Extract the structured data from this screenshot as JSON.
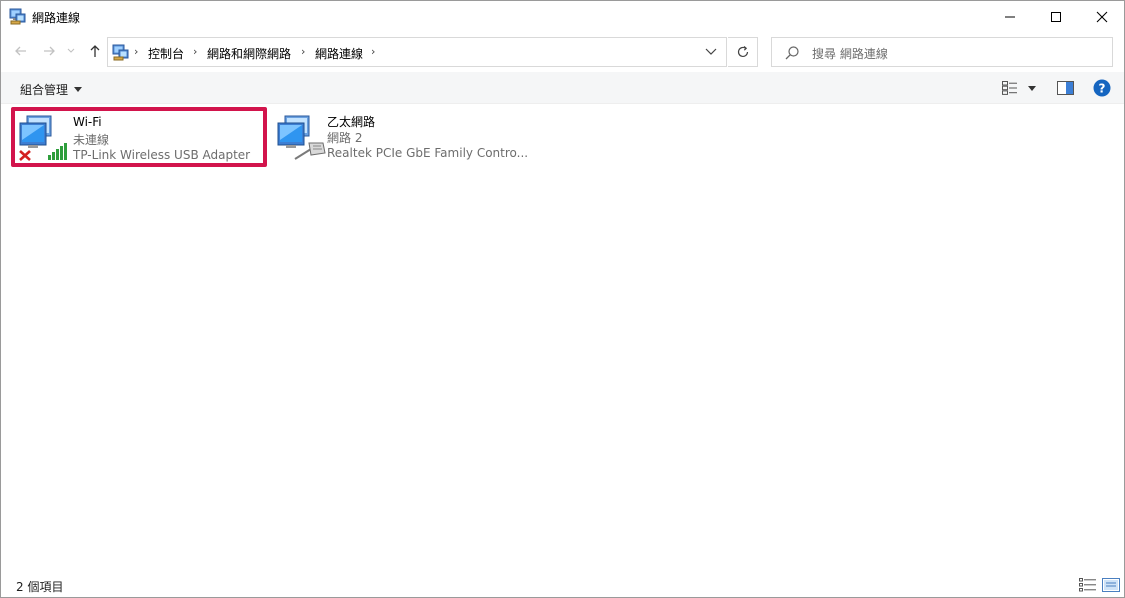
{
  "window": {
    "title": "網路連線"
  },
  "address": {
    "breadcrumbs": [
      "控制台",
      "網路和網際網路",
      "網路連線"
    ],
    "search_placeholder": "搜尋 網路連線"
  },
  "commandbar": {
    "organize_label": "組合管理"
  },
  "connections": [
    {
      "name": "Wi-Fi",
      "status": "未連線",
      "adapter": "TP-Link Wireless USB Adapter",
      "icon": "wifi-disconnected-icon",
      "selected": true
    },
    {
      "name": "乙太網路",
      "status": "網路 2",
      "adapter": "Realtek PCIe GbE Family Contro...",
      "icon": "ethernet-icon",
      "selected": false
    }
  ],
  "statusbar": {
    "item_count": "2 個項目"
  },
  "colors": {
    "selection_border": "#d2144c",
    "help_blue": "#1565c0",
    "disconnected_red": "#d32020",
    "signal_green": "#2e9e3c"
  }
}
